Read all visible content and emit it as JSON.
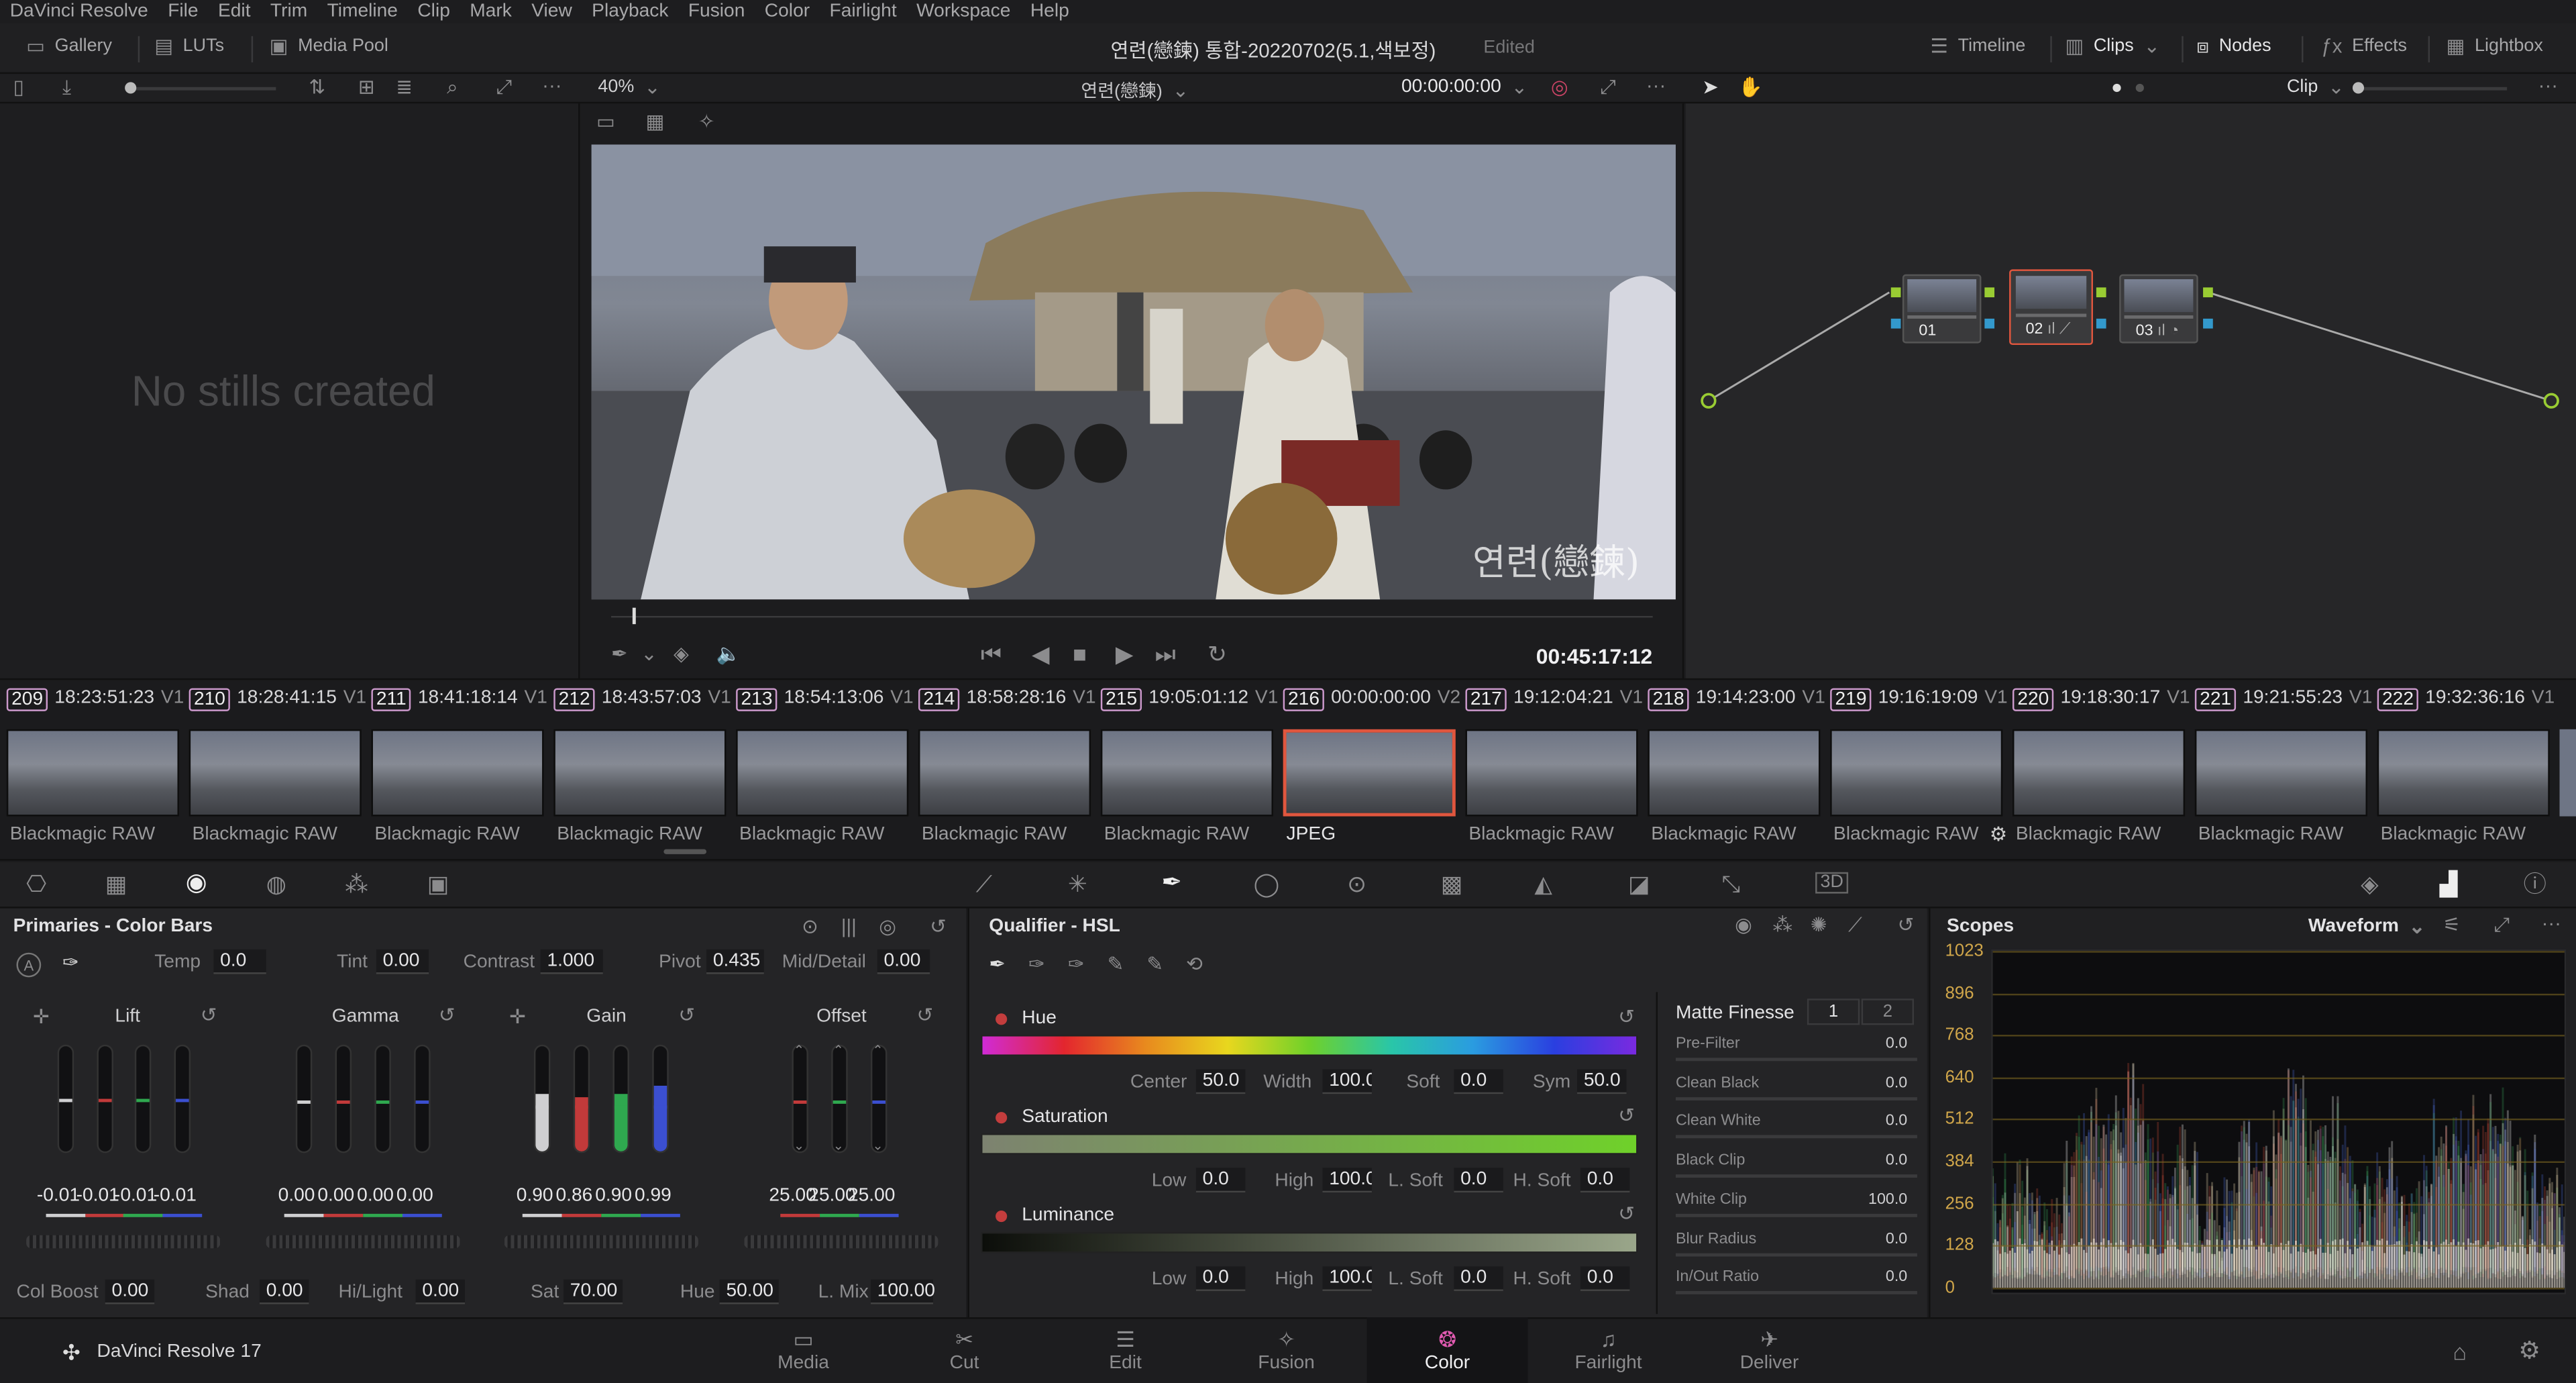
{
  "menu": [
    "DaVinci Resolve",
    "File",
    "Edit",
    "Trim",
    "Timeline",
    "Clip",
    "Mark",
    "View",
    "Playback",
    "Fusion",
    "Color",
    "Fairlight",
    "Workspace",
    "Help"
  ],
  "topbar": {
    "gallery": "Gallery",
    "luts": "LUTs",
    "media_pool": "Media Pool",
    "project_title": "연련(戀鍊) 통합-20220702(5.1,색보정)",
    "status": "Edited",
    "timeline": "Timeline",
    "clips": "Clips",
    "nodes": "Nodes",
    "effects": "Effects",
    "lightbox": "Lightbox"
  },
  "viewer": {
    "zoom": "40%",
    "timeline_name": "연련(戀鍊)",
    "timecode_top": "00:00:00:00",
    "timecode_bottom": "00:45:17:12",
    "watermark": "연련(戀鍊)",
    "playhead": 0.02
  },
  "nodes_bar": {
    "mode": "Clip"
  },
  "gallery": {
    "empty_text": "No stills created"
  },
  "node_graph": {
    "nodes": [
      {
        "label": "01"
      },
      {
        "label": "02"
      },
      {
        "label": "03"
      }
    ]
  },
  "clips": [
    {
      "num": "209",
      "tc": "18:23:51:23",
      "track": "V1",
      "codec": "Blackmagic RAW"
    },
    {
      "num": "210",
      "tc": "18:28:41:15",
      "track": "V1",
      "codec": "Blackmagic RAW"
    },
    {
      "num": "211",
      "tc": "18:41:18:14",
      "track": "V1",
      "codec": "Blackmagic RAW"
    },
    {
      "num": "212",
      "tc": "18:43:57:03",
      "track": "V1",
      "codec": "Blackmagic RAW"
    },
    {
      "num": "213",
      "tc": "18:54:13:06",
      "track": "V1",
      "codec": "Blackmagic RAW"
    },
    {
      "num": "214",
      "tc": "18:58:28:16",
      "track": "V1",
      "codec": "Blackmagic RAW"
    },
    {
      "num": "215",
      "tc": "19:05:01:12",
      "track": "V1",
      "codec": "Blackmagic RAW"
    },
    {
      "num": "216",
      "tc": "00:00:00:00",
      "track": "V2",
      "codec": "JPEG"
    },
    {
      "num": "217",
      "tc": "19:12:04:21",
      "track": "V1",
      "codec": "Blackmagic RAW"
    },
    {
      "num": "218",
      "tc": "19:14:23:00",
      "track": "V1",
      "codec": "Blackmagic RAW"
    },
    {
      "num": "219",
      "tc": "19:16:19:09",
      "track": "V1",
      "codec": "Blackmagic RAW"
    },
    {
      "num": "220",
      "tc": "19:18:30:17",
      "track": "V1",
      "codec": "Blackmagic RAW"
    },
    {
      "num": "221",
      "tc": "19:21:55:23",
      "track": "V1",
      "codec": "Blackmagic RAW"
    },
    {
      "num": "222",
      "tc": "19:32:36:16",
      "track": "V1",
      "codec": "Blackmagic RAW"
    }
  ],
  "primaries": {
    "title": "Primaries - Color Bars",
    "temp_label": "Temp",
    "temp": "0.0",
    "tint_label": "Tint",
    "tint": "0.00",
    "contrast_label": "Contrast",
    "contrast": "1.000",
    "pivot_label": "Pivot",
    "pivot": "0.435",
    "middetail_label": "Mid/Detail",
    "middetail": "0.00",
    "lift": {
      "label": "Lift",
      "values": [
        "-0.01",
        "-0.01",
        "-0.01",
        "-0.01"
      ]
    },
    "gamma": {
      "label": "Gamma",
      "values": [
        "0.00",
        "0.00",
        "0.00",
        "0.00"
      ]
    },
    "gain": {
      "label": "Gain",
      "values": [
        "0.90",
        "0.86",
        "0.90",
        "0.99"
      ]
    },
    "offset": {
      "label": "Offset",
      "values": [
        "25.00",
        "25.00",
        "25.00"
      ]
    },
    "colboost_label": "Col Boost",
    "colboost": "0.00",
    "shad_label": "Shad",
    "shad": "0.00",
    "hilight_label": "Hi/Light",
    "hilight": "0.00",
    "sat_label": "Sat",
    "sat": "70.00",
    "hue_label": "Hue",
    "hue": "50.00",
    "lmix_label": "L. Mix",
    "lmix": "100.00"
  },
  "qualifier": {
    "title": "Qualifier - HSL",
    "hue": {
      "label": "Hue",
      "center_label": "Center",
      "center": "50.0",
      "width_label": "Width",
      "width": "100.0",
      "soft_label": "Soft",
      "soft": "0.0",
      "sym_label": "Sym",
      "sym": "50.0"
    },
    "saturation": {
      "label": "Saturation",
      "low_label": "Low",
      "low": "0.0",
      "high_label": "High",
      "high": "100.0",
      "lsoft_label": "L. Soft",
      "lsoft": "0.0",
      "hsoft_label": "H. Soft",
      "hsoft": "0.0"
    },
    "luminance": {
      "label": "Luminance",
      "low_label": "Low",
      "low": "0.0",
      "high_label": "High",
      "high": "100.0",
      "lsoft_label": "L. Soft",
      "lsoft": "0.0",
      "hsoft_label": "H. Soft",
      "hsoft": "0.0"
    },
    "matte": {
      "title": "Matte Finesse",
      "tab1": "1",
      "tab2": "2",
      "rows": [
        {
          "label": "Pre-Filter",
          "value": "0.0"
        },
        {
          "label": "Clean Black",
          "value": "0.0"
        },
        {
          "label": "Clean White",
          "value": "0.0"
        },
        {
          "label": "Black Clip",
          "value": "0.0"
        },
        {
          "label": "White Clip",
          "value": "100.0"
        },
        {
          "label": "Blur Radius",
          "value": "0.0"
        },
        {
          "label": "In/Out Ratio",
          "value": "0.0"
        }
      ]
    }
  },
  "scopes": {
    "title": "Scopes",
    "mode": "Waveform",
    "ticks": [
      "1023",
      "896",
      "768",
      "640",
      "512",
      "384",
      "256",
      "128",
      "0"
    ]
  },
  "pages": [
    {
      "label": "Media",
      "icon": "media-icon"
    },
    {
      "label": "Cut",
      "icon": "cut-icon"
    },
    {
      "label": "Edit",
      "icon": "edit-icon"
    },
    {
      "label": "Fusion",
      "icon": "fusion-icon"
    },
    {
      "label": "Color",
      "icon": "color-icon"
    },
    {
      "label": "Fairlight",
      "icon": "fairlight-icon"
    },
    {
      "label": "Deliver",
      "icon": "deliver-icon"
    }
  ],
  "app_name": "DaVinci Resolve 17",
  "colors": {
    "accent_red": "#e0563e",
    "lift_red": "#c23a3a",
    "lift_green": "#2fa84f",
    "lift_blue": "#3b4fd0",
    "waveform_bg": "#0d0d0f"
  }
}
